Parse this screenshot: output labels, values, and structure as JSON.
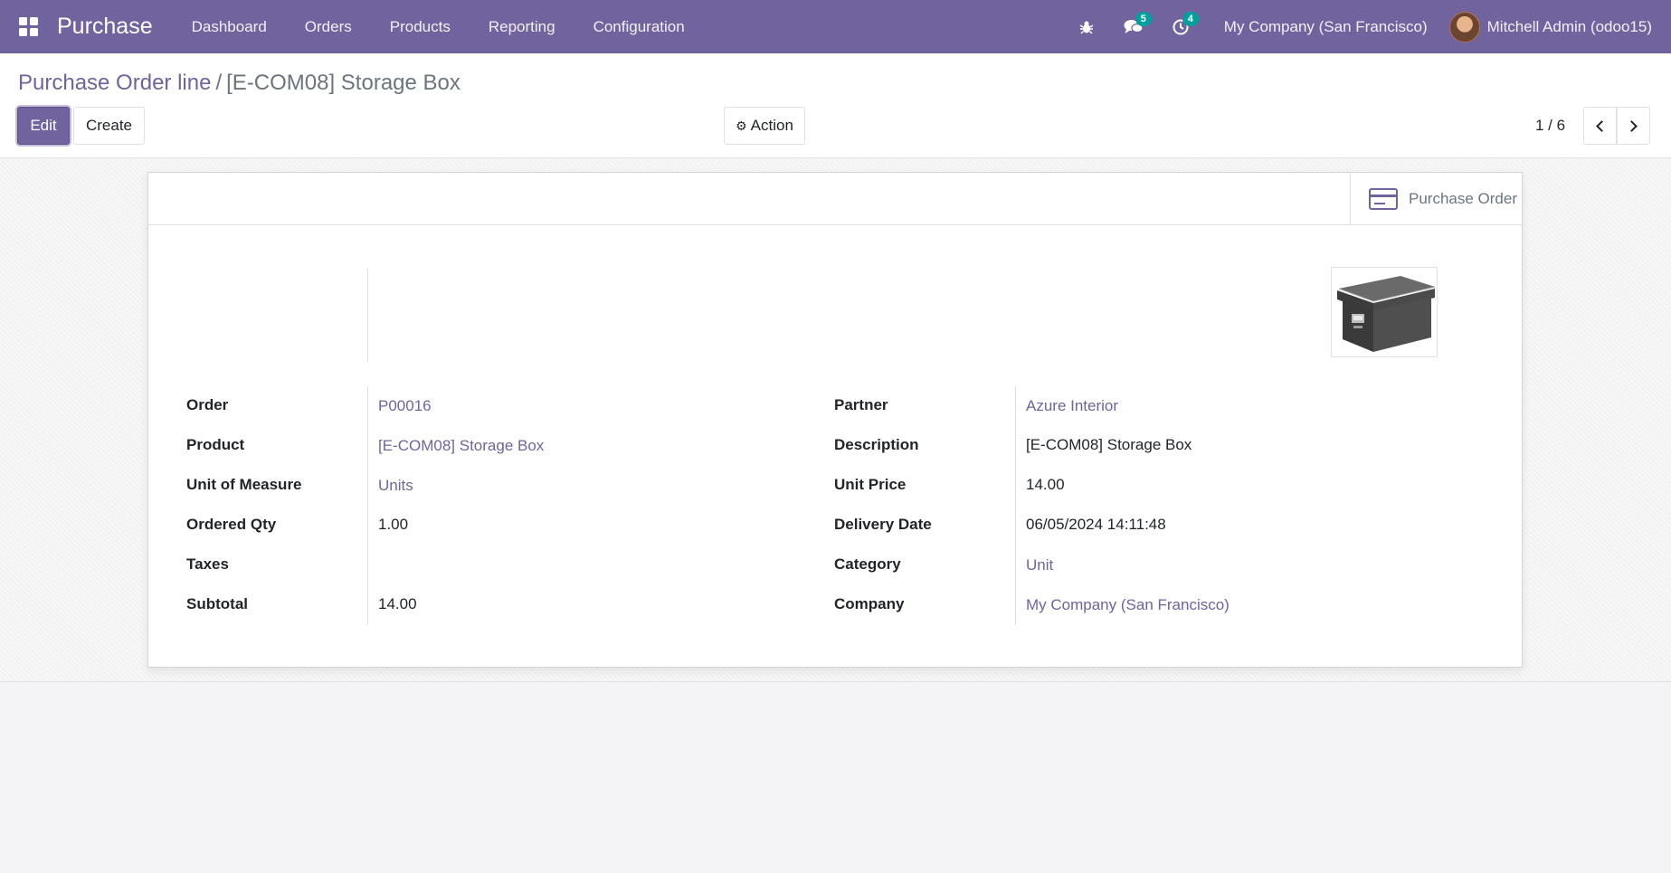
{
  "navbar": {
    "app_name": "Purchase",
    "menu": [
      "Dashboard",
      "Orders",
      "Products",
      "Reporting",
      "Configuration"
    ],
    "messages_count": "5",
    "activities_count": "4",
    "company": "My Company (San Francisco)",
    "user": "Mitchell Admin (odoo15)"
  },
  "breadcrumb": {
    "parent": "Purchase Order line",
    "separator": "/",
    "current": "[E-COM08] Storage Box"
  },
  "toolbar": {
    "edit_label": "Edit",
    "create_label": "Create",
    "action_label": "Action",
    "pager": "1 / 6"
  },
  "button_box": {
    "purchase_order_label": "Purchase Order"
  },
  "left_fields": [
    {
      "label": "Order",
      "value": "P00016",
      "link": true
    },
    {
      "label": "Product",
      "value": "[E-COM08] Storage Box",
      "link": true
    },
    {
      "label": "Unit of Measure",
      "value": "Units",
      "link": true
    },
    {
      "label": "Ordered Qty",
      "value": "1.00",
      "link": false
    },
    {
      "label": "Taxes",
      "value": "",
      "link": false
    },
    {
      "label": "Subtotal",
      "value": "14.00",
      "link": false
    }
  ],
  "right_fields": [
    {
      "label": "Partner",
      "value": "Azure Interior",
      "link": true
    },
    {
      "label": "Description",
      "value": "[E-COM08] Storage Box",
      "link": false
    },
    {
      "label": "Unit Price",
      "value": "14.00",
      "link": false
    },
    {
      "label": "Delivery Date",
      "value": "06/05/2024 14:11:48",
      "link": false
    },
    {
      "label": "Category",
      "value": "Unit",
      "link": true
    },
    {
      "label": "Company",
      "value": "My Company (San Francisco)",
      "link": true
    }
  ],
  "colors": {
    "brand": "#71639e",
    "badge": "#00a09d"
  }
}
